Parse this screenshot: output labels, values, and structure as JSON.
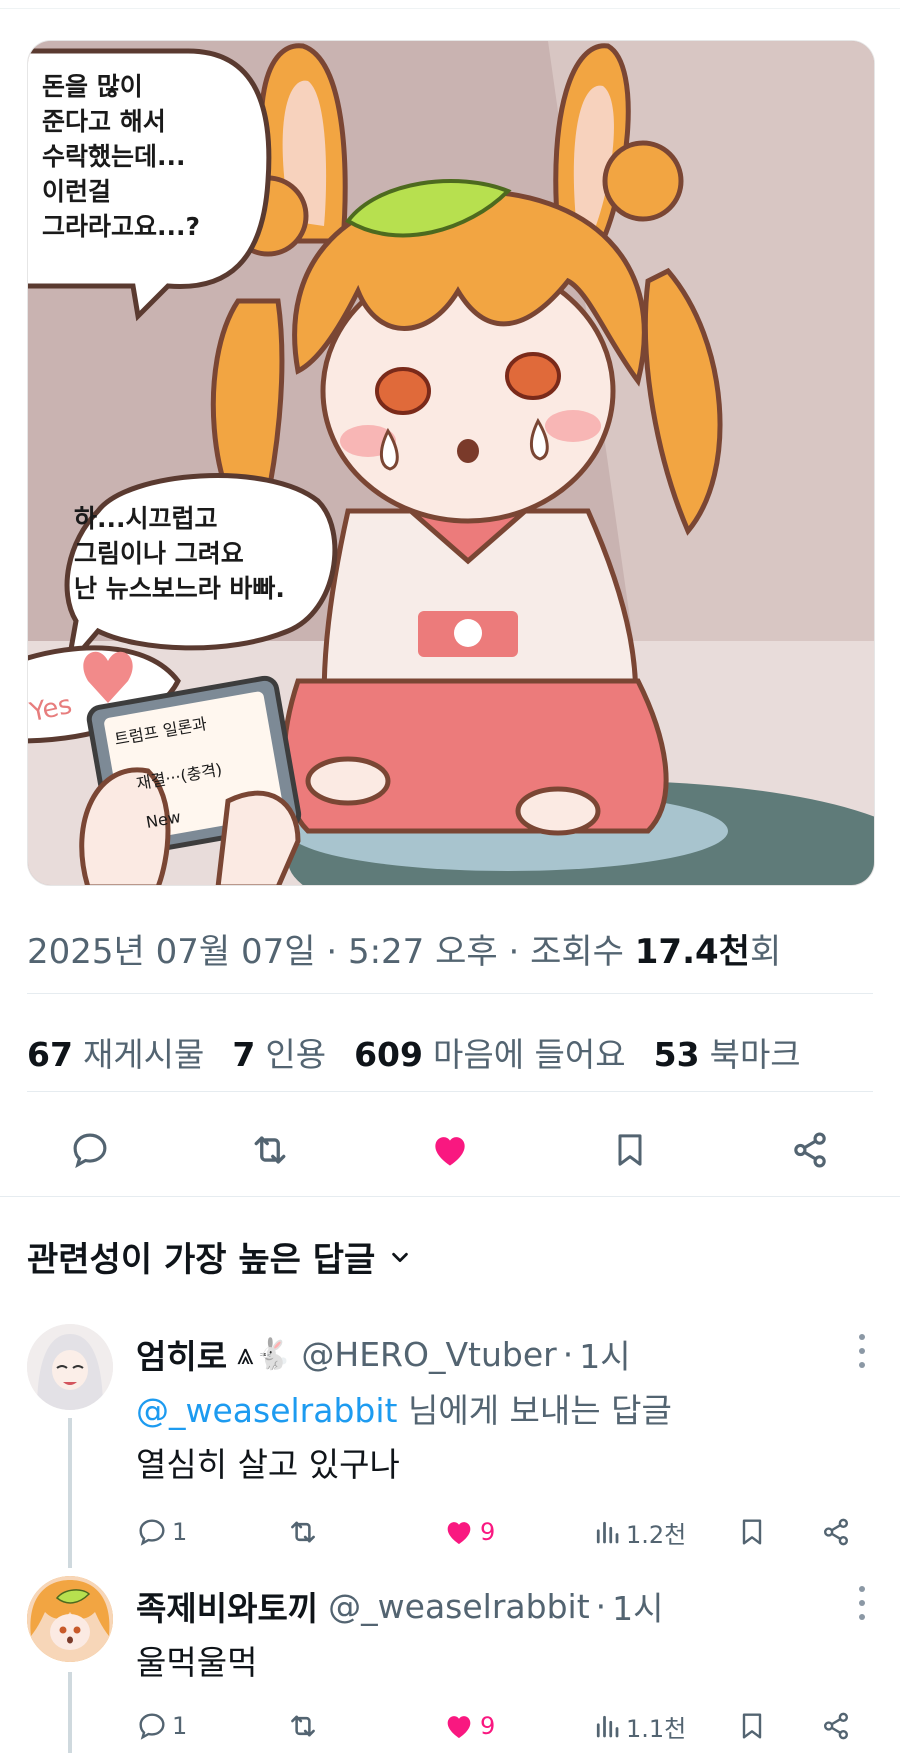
{
  "post": {
    "image": {
      "bubble_top": "돈을 많이\n준다고 해서\n수락했는데...\n이런걸\n그라라고요...?",
      "bubble_mid": "하...시끄럽고\n그림이나 그려요\n난 뉴스보느라 바빠.",
      "card_yes": "Yes",
      "card_line1": "트럼프 일론과",
      "card_line2": "재결···(충격)",
      "card_new": "New"
    },
    "meta": {
      "date": "2025년 07월 07일",
      "time": "5:27 오후",
      "views_label": "조회수",
      "views_value": "17.4천",
      "views_suffix": "회",
      "sep": "·"
    },
    "stats": {
      "reposts": "67",
      "reposts_label": "재게시물",
      "quotes": "7",
      "quotes_label": "인용",
      "likes": "609",
      "likes_label": "마음에 들어요",
      "bookmarks": "53",
      "bookmarks_label": "북마크"
    }
  },
  "icons": {
    "reply": "reply-icon",
    "repost": "repost-icon",
    "like": "heart-icon",
    "bookmark": "bookmark-icon",
    "share": "share-icon",
    "views": "bar-chart-icon",
    "chevron": "chevron-down-icon",
    "more": "more-vertical-icon"
  },
  "colors": {
    "like": "#f91880",
    "mention": "#1d9bf0",
    "muted": "#536471"
  },
  "sort": {
    "label": "관련성이 가장 높은 답글"
  },
  "replies": [
    {
      "name": "엄히로",
      "badge": "⩓🐇",
      "handle": "@HERO_Vtuber",
      "time": "1시",
      "reply_to_handle": "@_weaselrabbit",
      "reply_to_suffix": "님에게 보내는 답글",
      "text": "열심히 살고 있구나",
      "replies": "1",
      "likes": "9",
      "views": "1.2천"
    },
    {
      "name": "족제비와토끼",
      "handle": "@_weaselrabbit",
      "time": "1시",
      "text": "울먹울먹",
      "replies": "1",
      "likes": "9",
      "views": "1.1천"
    }
  ]
}
